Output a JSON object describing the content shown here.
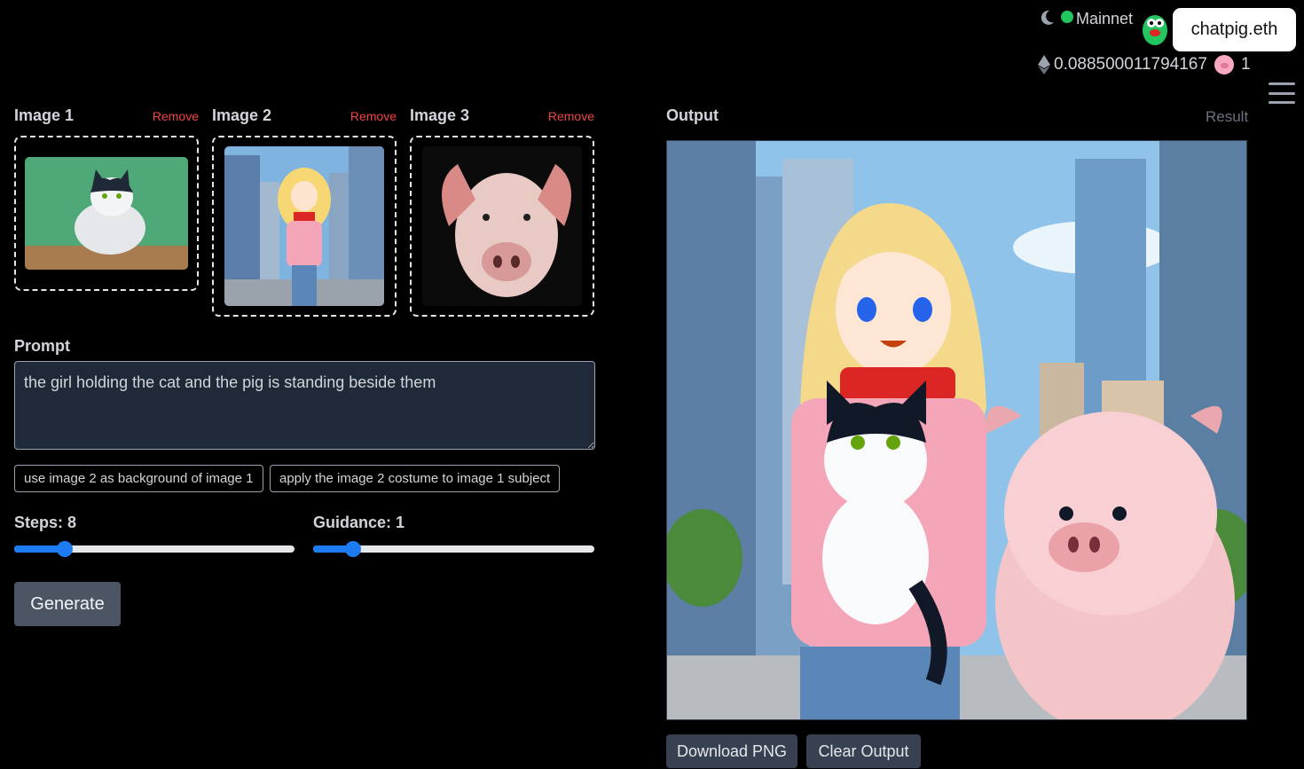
{
  "header": {
    "network_label": "Mainnet",
    "account_label": "chatpig.eth",
    "balance": "0.088500011794167",
    "token_count": "1"
  },
  "images": [
    {
      "title": "Image 1",
      "remove_label": "Remove"
    },
    {
      "title": "Image 2",
      "remove_label": "Remove"
    },
    {
      "title": "Image 3",
      "remove_label": "Remove"
    }
  ],
  "prompt": {
    "label": "Prompt",
    "value": "the girl holding the cat and the pig is standing beside them"
  },
  "suggestions": [
    "use image 2 as background of image 1",
    "apply the image 2 costume to image 1 subject"
  ],
  "steps": {
    "label": "Steps: 8",
    "value": 8,
    "fraction": 0.16
  },
  "guidance": {
    "label": "Guidance: 1",
    "value": 1,
    "fraction": 0.12
  },
  "generate_label": "Generate",
  "output": {
    "label": "Output",
    "result_tab": "Result",
    "download_label": "Download PNG",
    "clear_label": "Clear Output"
  },
  "colors": {
    "accent": "#1d7cf2",
    "remove": "#ef4444",
    "network_dot": "#22c55e"
  }
}
